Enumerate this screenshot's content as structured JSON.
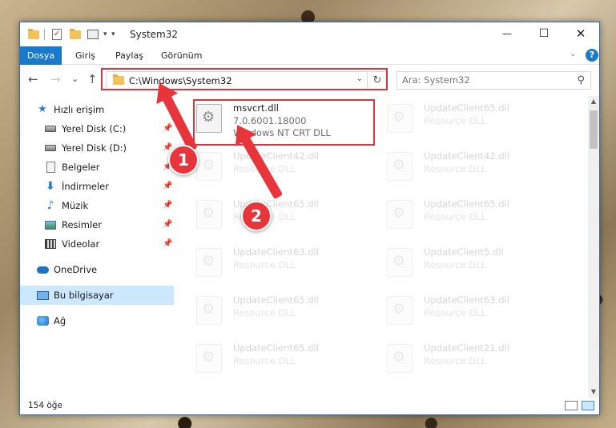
{
  "window": {
    "title": "System32",
    "minimize_glyph": "—",
    "maximize_glyph": "☐",
    "close_glyph": "✕"
  },
  "quick_access": {
    "icons": [
      "folder-icon",
      "properties-check-icon",
      "new-folder-icon",
      "customize-icon"
    ],
    "dropdown_glyph": "▾"
  },
  "ribbon": {
    "tabs": [
      "Dosya",
      "Giriş",
      "Paylaş",
      "Görünüm"
    ],
    "collapse_glyph": "⌄",
    "help_glyph": "?"
  },
  "nav": {
    "back_glyph": "←",
    "forward_glyph": "→",
    "recent_glyph": "⌄",
    "up_glyph": "↑"
  },
  "address": {
    "path": "C:\\Windows\\System32",
    "dropdown_glyph": "⌄",
    "refresh_glyph": "↻"
  },
  "search": {
    "placeholder": "Ara: System32",
    "icon_glyph": "⚲"
  },
  "sidebar": {
    "items": [
      {
        "label": "Hızlı erişim",
        "icon": "star-icon",
        "glyph": "★",
        "pinned": false
      },
      {
        "label": "Yerel Disk (C:)",
        "icon": "disk-icon",
        "glyph": "",
        "pinned": true
      },
      {
        "label": "Yerel Disk (D:)",
        "icon": "disk-icon",
        "glyph": "",
        "pinned": true
      },
      {
        "label": "Belgeler",
        "icon": "documents-icon",
        "glyph": "",
        "pinned": true
      },
      {
        "label": "İndirmeler",
        "icon": "download-icon",
        "glyph": "⬇",
        "pinned": true
      },
      {
        "label": "Müzik",
        "icon": "music-icon",
        "glyph": "♪",
        "pinned": true
      },
      {
        "label": "Resimler",
        "icon": "pictures-icon",
        "glyph": "",
        "pinned": true
      },
      {
        "label": "Videolar",
        "icon": "videos-icon",
        "glyph": "",
        "pinned": true
      },
      {
        "label": "OneDrive",
        "icon": "onedrive-icon",
        "glyph": "",
        "pinned": false
      },
      {
        "label": "Bu bilgisayar",
        "icon": "this-pc-icon",
        "glyph": "",
        "pinned": false,
        "selected": true
      },
      {
        "label": "Ağ",
        "icon": "network-icon",
        "glyph": "",
        "pinned": false
      }
    ],
    "pin_glyph": "📌"
  },
  "files": {
    "highlighted": {
      "name": "msvcrt.dll",
      "version": "7.0.6001.18000",
      "description": "Windows NT CRT DLL"
    },
    "items": [
      {
        "name": "UpdateClient65.dll",
        "description": "Resource DLL"
      },
      {
        "name": "UpdateClient42.dll",
        "description": "Resource DLL"
      },
      {
        "name": "UpdateClient42.dll",
        "description": "Resource DLL"
      },
      {
        "name": "UpdateClient65.dll",
        "description": "Resource DLL"
      },
      {
        "name": "UpdateClient65.dll",
        "description": "Resource DLL"
      },
      {
        "name": "UpdateClient63.dll",
        "description": "Resource DLL"
      },
      {
        "name": "UpdateClient5.dll",
        "description": "Resource DLL"
      },
      {
        "name": "UpdateClient65.dll",
        "description": "Resource DLL"
      },
      {
        "name": "UpdateClient63.dll",
        "description": "Resource DLL"
      },
      {
        "name": "UpdateClient65.dll",
        "description": "Resource DLL"
      },
      {
        "name": "UpdateClient21.dll",
        "description": "Resource DLL"
      }
    ]
  },
  "scrollbar": {
    "up_glyph": "▲",
    "down_glyph": "▼"
  },
  "status": {
    "item_count": "154 öğe"
  },
  "annotations": {
    "badge_1": "1",
    "badge_2": "2"
  },
  "colors": {
    "accent": "#1979ca",
    "highlight_red": "#d9363e",
    "selection": "#cce8ff"
  }
}
